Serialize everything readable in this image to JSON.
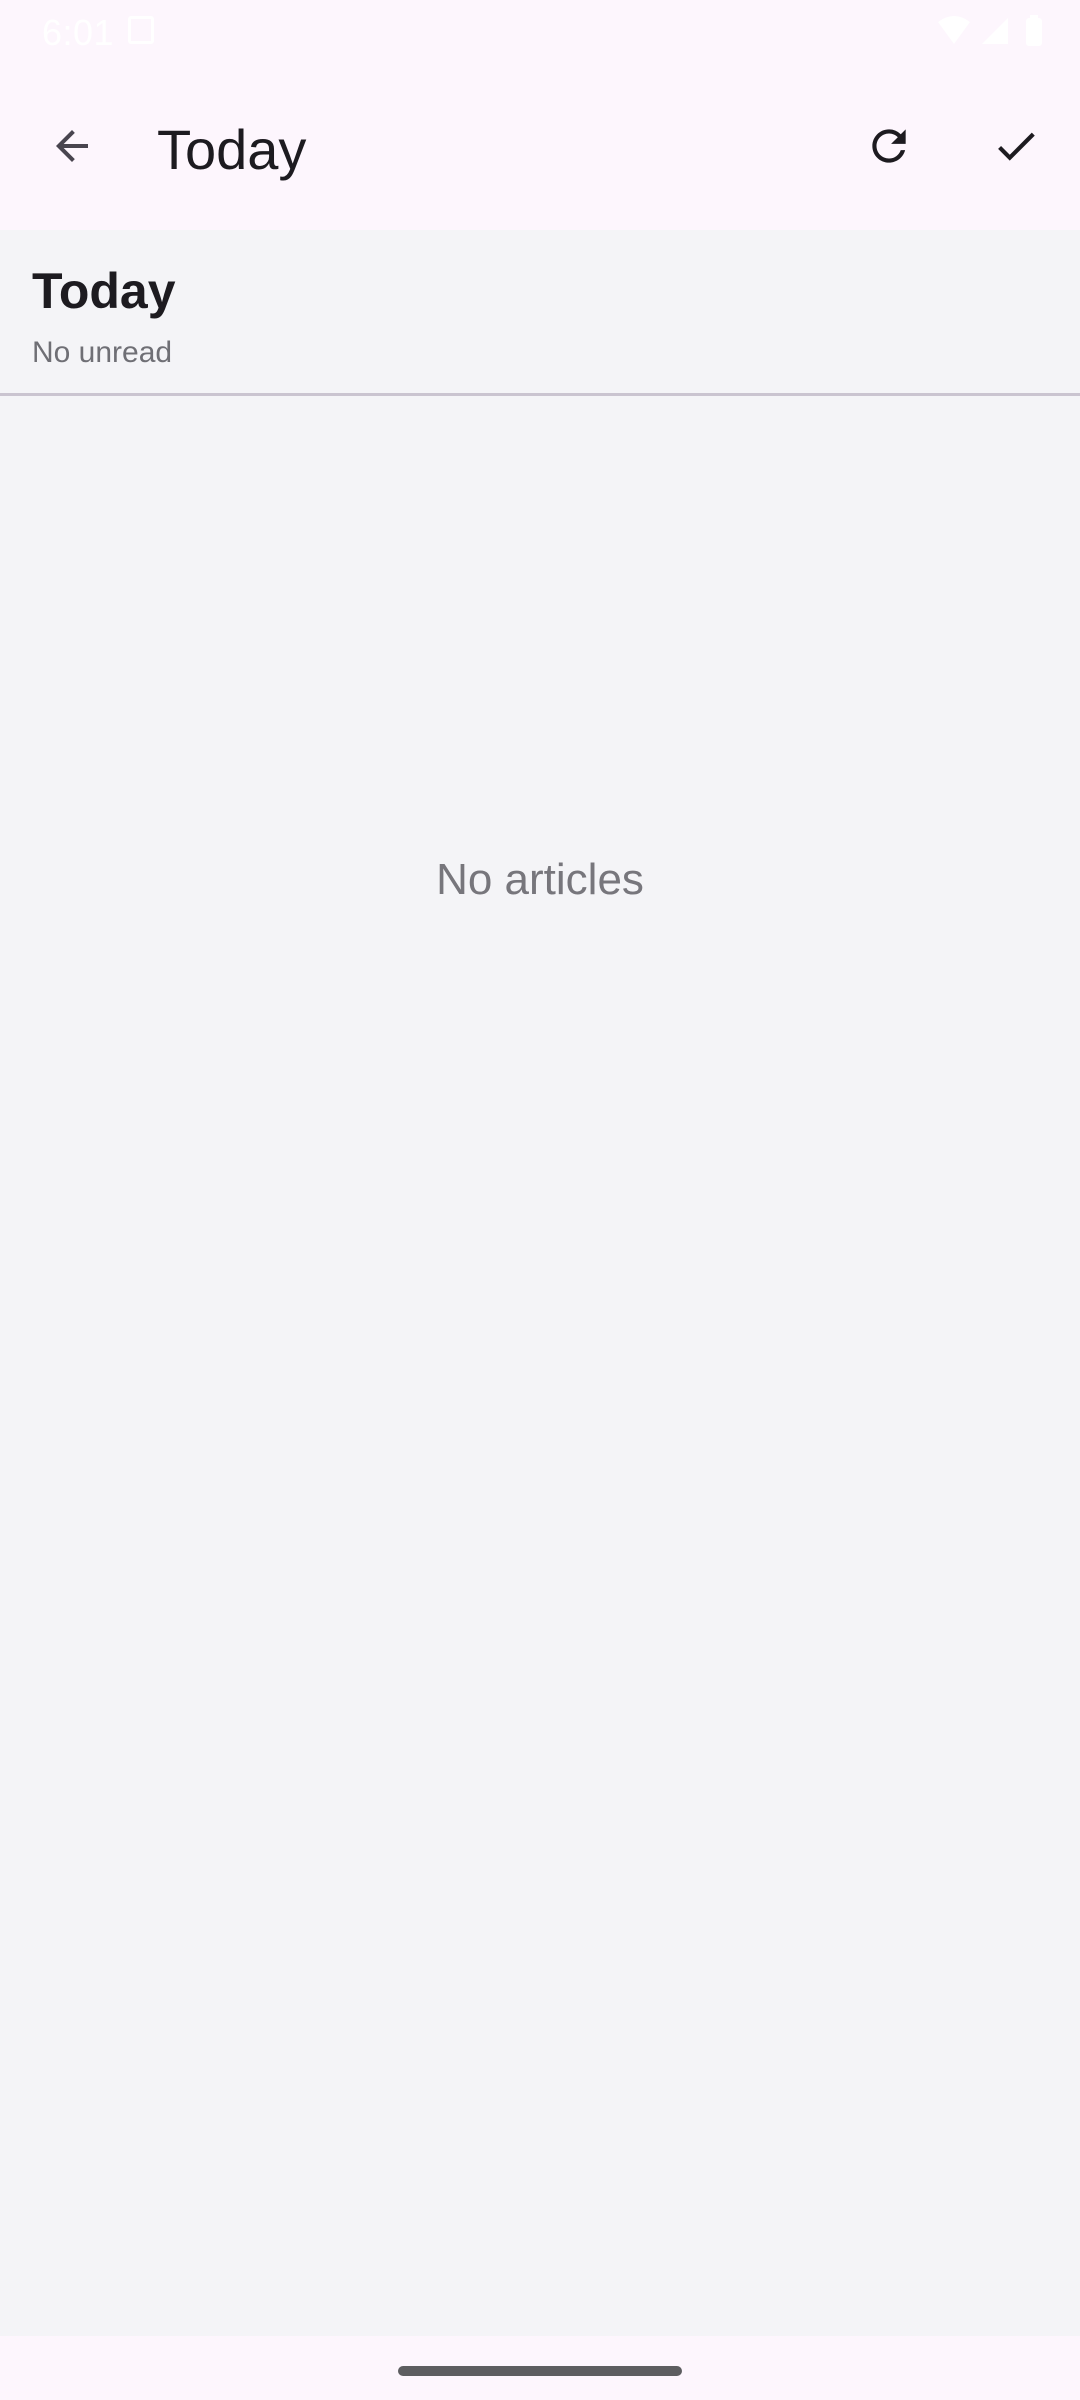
{
  "status_bar": {
    "time": "6:01",
    "icons": [
      "sim-card-icon",
      "wifi-icon",
      "signal-icon",
      "battery-icon"
    ],
    "text_color": "#ffffff"
  },
  "app_bar": {
    "title": "Today",
    "back_icon": "arrow-back-icon",
    "actions": [
      {
        "icon": "refresh-icon",
        "name": "refresh"
      },
      {
        "icon": "check-icon",
        "name": "mark-all-read"
      }
    ],
    "background": "#fdf6fd"
  },
  "section": {
    "title": "Today",
    "subtitle": "No unread"
  },
  "content": {
    "empty_message": "No articles",
    "background": "#f4f4f7"
  }
}
